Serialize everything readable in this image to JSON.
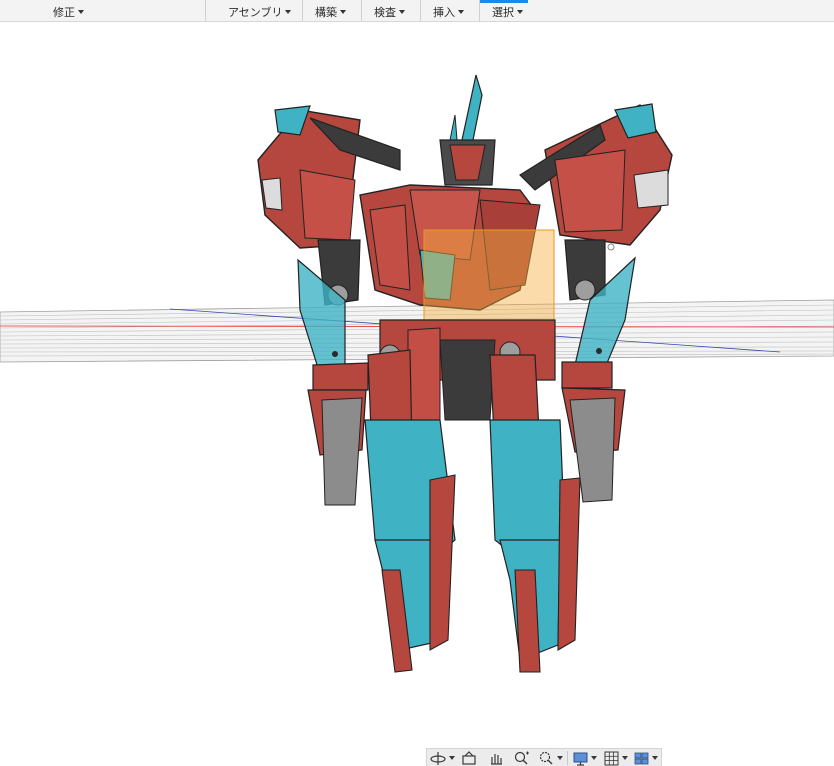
{
  "toolbar": {
    "items": [
      {
        "label": "修正"
      },
      {
        "label": "アセンブリ"
      },
      {
        "label": "構築"
      },
      {
        "label": "検査"
      },
      {
        "label": "挿入"
      },
      {
        "label": "選択"
      }
    ],
    "accent_color": "#1e88e5"
  },
  "viewport": {
    "model": "robot-assembly",
    "colors": {
      "red_armor": "#b5473f",
      "cyan_armor": "#3fb3c4",
      "dark_frame": "#3b3b3b",
      "light_grey": "#d8d8d8",
      "selection": "#f5b041"
    }
  },
  "navbar": {
    "tools": [
      {
        "icon": "orbit-icon",
        "has_dropdown": true
      },
      {
        "icon": "look-at-icon",
        "has_dropdown": false
      },
      {
        "icon": "pan-icon",
        "has_dropdown": false
      },
      {
        "icon": "zoom-icon",
        "has_dropdown": false
      },
      {
        "icon": "fit-icon",
        "has_dropdown": true
      },
      {
        "icon": "display-settings-icon",
        "has_dropdown": true
      },
      {
        "icon": "grid-icon",
        "has_dropdown": true
      },
      {
        "icon": "viewports-icon",
        "has_dropdown": true
      }
    ]
  }
}
